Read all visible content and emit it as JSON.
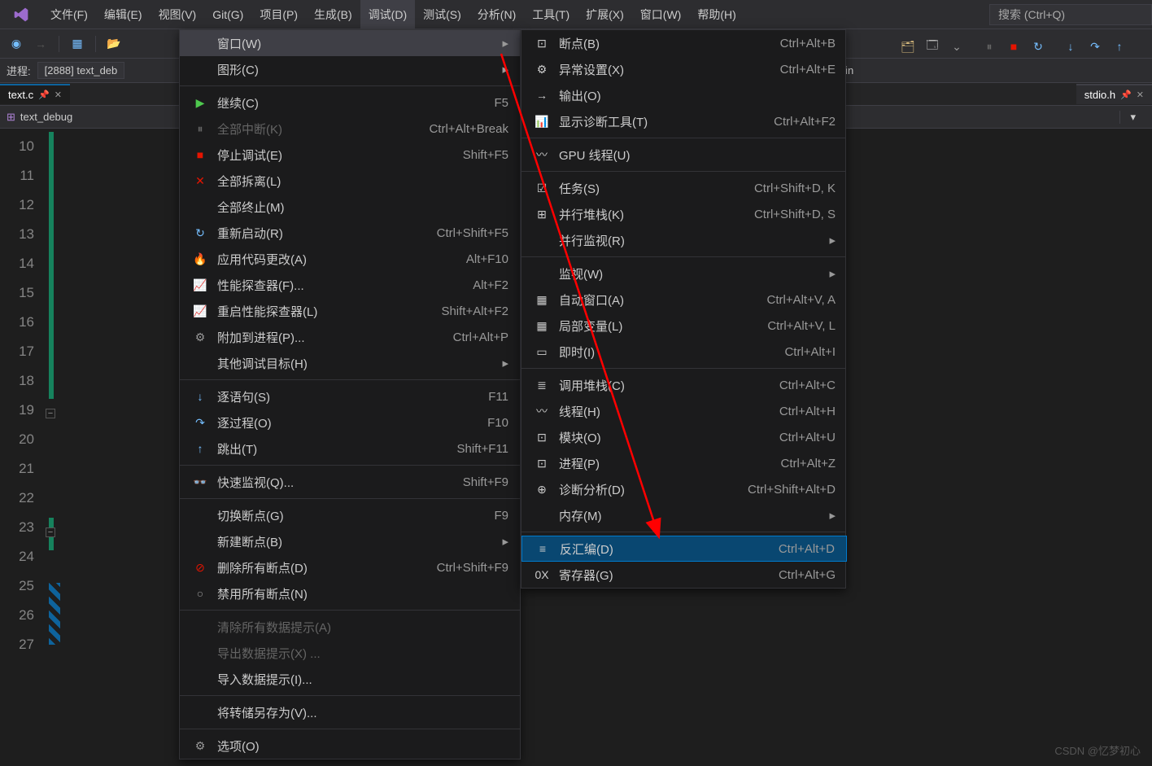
{
  "menubar": {
    "items": [
      "文件(F)",
      "编辑(E)",
      "视图(V)",
      "Git(G)",
      "项目(P)",
      "生成(B)",
      "调试(D)",
      "测试(S)",
      "分析(N)",
      "工具(T)",
      "扩展(X)",
      "窗口(W)",
      "帮助(H)"
    ],
    "active_index": 6,
    "search_placeholder": "搜索 (Ctrl+Q)"
  },
  "process_bar": {
    "label": "进程:",
    "value": "[2888] text_deb"
  },
  "stack_dropdown": "main",
  "tabs": {
    "main": "text.c",
    "right": "stdio.h"
  },
  "project": "text_debug",
  "line_numbers": [
    "10",
    "11",
    "12",
    "13",
    "14",
    "15",
    "16",
    "17",
    "18",
    "19",
    "20",
    "21",
    "22",
    "23",
    "24",
    "25",
    "26",
    "27"
  ],
  "debug_menu": [
    {
      "type": "item",
      "icon": "",
      "label": "窗口(W)",
      "shortcut": "",
      "sub": true,
      "highlighted": true
    },
    {
      "type": "item",
      "icon": "",
      "label": "图形(C)",
      "shortcut": "",
      "sub": true
    },
    {
      "type": "sep"
    },
    {
      "type": "item",
      "icon": "▶",
      "iconColor": "#4ec94e",
      "label": "继续(C)",
      "shortcut": "F5"
    },
    {
      "type": "item",
      "icon": "⏸",
      "iconColor": "#656565",
      "label": "全部中断(K)",
      "shortcut": "Ctrl+Alt+Break",
      "disabled": true
    },
    {
      "type": "item",
      "icon": "■",
      "iconColor": "#e51400",
      "label": "停止调试(E)",
      "shortcut": "Shift+F5"
    },
    {
      "type": "item",
      "icon": "✕",
      "iconColor": "#e51400",
      "label": "全部拆离(L)",
      "shortcut": ""
    },
    {
      "type": "item",
      "icon": "",
      "label": "全部终止(M)",
      "shortcut": ""
    },
    {
      "type": "item",
      "icon": "↻",
      "iconColor": "#75beff",
      "label": "重新启动(R)",
      "shortcut": "Ctrl+Shift+F5"
    },
    {
      "type": "item",
      "icon": "🔥",
      "iconColor": "#d16949",
      "label": "应用代码更改(A)",
      "shortcut": "Alt+F10"
    },
    {
      "type": "item",
      "icon": "📈",
      "iconColor": "#75beff",
      "label": "性能探查器(F)...",
      "shortcut": "Alt+F2"
    },
    {
      "type": "item",
      "icon": "📈",
      "iconColor": "#75beff",
      "label": "重启性能探查器(L)",
      "shortcut": "Shift+Alt+F2"
    },
    {
      "type": "item",
      "icon": "⚙",
      "iconColor": "#999",
      "label": "附加到进程(P)...",
      "shortcut": "Ctrl+Alt+P"
    },
    {
      "type": "item",
      "icon": "",
      "label": "其他调试目标(H)",
      "shortcut": "",
      "sub": true
    },
    {
      "type": "sep"
    },
    {
      "type": "item",
      "icon": "↓",
      "iconColor": "#75beff",
      "label": "逐语句(S)",
      "shortcut": "F11"
    },
    {
      "type": "item",
      "icon": "↷",
      "iconColor": "#75beff",
      "label": "逐过程(O)",
      "shortcut": "F10"
    },
    {
      "type": "item",
      "icon": "↑",
      "iconColor": "#75beff",
      "label": "跳出(T)",
      "shortcut": "Shift+F11"
    },
    {
      "type": "sep"
    },
    {
      "type": "item",
      "icon": "👓",
      "iconColor": "#999",
      "label": "快速监视(Q)...",
      "shortcut": "Shift+F9"
    },
    {
      "type": "sep"
    },
    {
      "type": "item",
      "icon": "",
      "label": "切换断点(G)",
      "shortcut": "F9"
    },
    {
      "type": "item",
      "icon": "",
      "label": "新建断点(B)",
      "shortcut": "",
      "sub": true
    },
    {
      "type": "item",
      "icon": "⊘",
      "iconColor": "#e51400",
      "label": "删除所有断点(D)",
      "shortcut": "Ctrl+Shift+F9"
    },
    {
      "type": "item",
      "icon": "○",
      "iconColor": "#999",
      "label": "禁用所有断点(N)",
      "shortcut": ""
    },
    {
      "type": "sep"
    },
    {
      "type": "item",
      "icon": "",
      "label": "清除所有数据提示(A)",
      "shortcut": "",
      "disabled": true
    },
    {
      "type": "item",
      "icon": "",
      "label": "导出数据提示(X) ...",
      "shortcut": "",
      "disabled": true
    },
    {
      "type": "item",
      "icon": "",
      "label": "导入数据提示(I)...",
      "shortcut": ""
    },
    {
      "type": "sep"
    },
    {
      "type": "item",
      "icon": "",
      "label": "将转储另存为(V)...",
      "shortcut": ""
    },
    {
      "type": "sep"
    },
    {
      "type": "item",
      "icon": "⚙",
      "iconColor": "#999",
      "label": "选项(O)",
      "shortcut": ""
    }
  ],
  "window_submenu": [
    {
      "type": "item",
      "icon": "⊡",
      "label": "断点(B)",
      "shortcut": "Ctrl+Alt+B"
    },
    {
      "type": "item",
      "icon": "⚙",
      "label": "异常设置(X)",
      "shortcut": "Ctrl+Alt+E"
    },
    {
      "type": "item",
      "icon": "→",
      "label": "输出(O)",
      "shortcut": ""
    },
    {
      "type": "item",
      "icon": "📊",
      "label": "显示诊断工具(T)",
      "shortcut": "Ctrl+Alt+F2"
    },
    {
      "type": "sep"
    },
    {
      "type": "item",
      "icon": "〰",
      "label": "GPU 线程(U)",
      "shortcut": ""
    },
    {
      "type": "sep"
    },
    {
      "type": "item",
      "icon": "☑",
      "label": "任务(S)",
      "shortcut": "Ctrl+Shift+D, K"
    },
    {
      "type": "item",
      "icon": "⊞",
      "label": "并行堆栈(K)",
      "shortcut": "Ctrl+Shift+D, S"
    },
    {
      "type": "item",
      "icon": "",
      "label": "并行监视(R)",
      "shortcut": "",
      "sub": true
    },
    {
      "type": "sep"
    },
    {
      "type": "item",
      "icon": "",
      "label": "监视(W)",
      "shortcut": "",
      "sub": true
    },
    {
      "type": "item",
      "icon": "▦",
      "label": "自动窗口(A)",
      "shortcut": "Ctrl+Alt+V, A"
    },
    {
      "type": "item",
      "icon": "▦",
      "label": "局部变量(L)",
      "shortcut": "Ctrl+Alt+V, L"
    },
    {
      "type": "item",
      "icon": "▭",
      "label": "即时(I)",
      "shortcut": "Ctrl+Alt+I"
    },
    {
      "type": "sep"
    },
    {
      "type": "item",
      "icon": "≣",
      "label": "调用堆栈(C)",
      "shortcut": "Ctrl+Alt+C",
      "annot_through": true
    },
    {
      "type": "item",
      "icon": "〰",
      "label": "线程(H)",
      "shortcut": "Ctrl+Alt+H"
    },
    {
      "type": "item",
      "icon": "⊡",
      "label": "模块(O)",
      "shortcut": "Ctrl+Alt+U"
    },
    {
      "type": "item",
      "icon": "⊡",
      "label": "进程(P)",
      "shortcut": "Ctrl+Alt+Z"
    },
    {
      "type": "item",
      "icon": "⊕",
      "label": "诊断分析(D)",
      "shortcut": "Ctrl+Shift+Alt+D"
    },
    {
      "type": "item",
      "icon": "",
      "label": "内存(M)",
      "shortcut": "",
      "sub": true
    },
    {
      "type": "sep"
    },
    {
      "type": "item",
      "icon": "≡",
      "label": "反汇编(D)",
      "shortcut": "Ctrl+Alt+D",
      "target": true
    },
    {
      "type": "item",
      "icon": "0X",
      "label": "寄存器(G)",
      "shortcut": "Ctrl+Alt+G"
    }
  ],
  "watermark": "CSDN @忆梦初心"
}
